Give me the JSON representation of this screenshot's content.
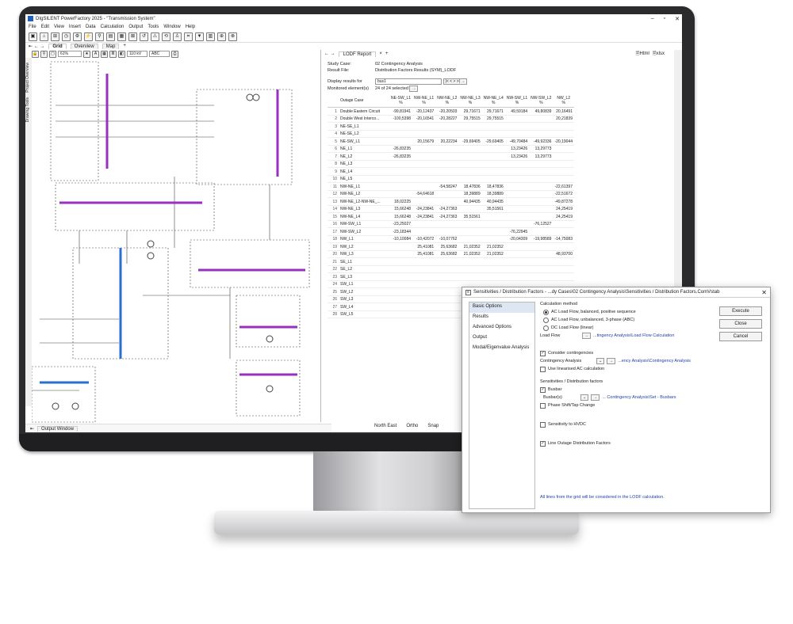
{
  "window": {
    "title": "DIgSILENT PowerFactory 2025 - \"Transmission System\""
  },
  "menu": [
    "File",
    "Edit",
    "View",
    "Insert",
    "Data",
    "Calculation",
    "Output",
    "Tools",
    "Window",
    "Help"
  ],
  "left_tabs": [
    "Grid",
    "Overview",
    "Map"
  ],
  "left_side_tabs": [
    "Project Overview",
    "Drawing Tools"
  ],
  "zoom": "61%",
  "voltage_filter": "110 kV",
  "phase_filter": "ABC",
  "report": {
    "tab": "LODF Report",
    "study_case_label": "Study Case:",
    "study_case": "02 Contingency Analysis",
    "result_file_label": "Result File:",
    "result_file": "Distribution Factors Results (SYM)_LODF",
    "display_for_label": "Display results for",
    "display_for": "bus1",
    "monitored_label": "Monitored element(s)",
    "monitored": "24 of 24 selected",
    "export_html": "Html",
    "export_xlsx": "xlsx",
    "columns": [
      "Outage Case",
      "NE-SW_L1",
      "NW-NE_L1",
      "NW-NE_L2",
      "NW-NE_L3",
      "NW-NE_L4",
      "NW-SW_L1",
      "NW-SW_L2",
      "NW_L2"
    ],
    "unit": "%",
    "rows": [
      [
        "Double Eastern Circuit",
        "-99,81941",
        "-20,12437",
        "-20,20503",
        "29,71671",
        "29,71671",
        "49,59184",
        "49,80839",
        "20,16491"
      ],
      [
        "Double West Interco...",
        "-100,5398",
        "-20,16541",
        "-20,28227",
        "29,75515",
        "29,75515",
        "",
        "",
        "20,21839"
      ],
      [
        "NE-SE_L1",
        "",
        "",
        "",
        "",
        "",
        "",
        "",
        ""
      ],
      [
        "NE-SE_L2",
        "",
        "",
        "",
        "",
        "",
        "",
        "",
        ""
      ],
      [
        "NE-SW_L1",
        "",
        "20,15679",
        "20,22234",
        "-29,69405",
        "-29,69405",
        "-49,70484",
        "-49,92336",
        "-20,19044"
      ],
      [
        "NE_L1",
        "-26,83235",
        "",
        "",
        "",
        "",
        "13,23426",
        "13,29773",
        ""
      ],
      [
        "NE_L2",
        "-26,83235",
        "",
        "",
        "",
        "",
        "13,23426",
        "13,29773",
        ""
      ],
      [
        "NE_L3",
        "",
        "",
        "",
        "",
        "",
        "",
        "",
        ""
      ],
      [
        "NE_L4",
        "",
        "",
        "",
        "",
        "",
        "",
        "",
        ""
      ],
      [
        "NE_L5",
        "",
        "",
        "",
        "",
        "",
        "",
        "",
        ""
      ],
      [
        "NW-NE_L1",
        "",
        "",
        "-54,58247",
        "18,47836",
        "18,47836",
        "",
        "",
        "-22,61397"
      ],
      [
        "NW-NE_L2",
        "",
        "-54,64618",
        "",
        "18,39889",
        "18,39889",
        "",
        "",
        "-22,51672"
      ],
      [
        "NW-NE_L2-NW-NE_...",
        "18,02225",
        "",
        "",
        "40,94435",
        "40,94435",
        "",
        "",
        "-49,87278"
      ],
      [
        "NW-NE_L3",
        "15,66248",
        "-24,23841",
        "-24,27363",
        "",
        "35,51561",
        "",
        "",
        "24,25419"
      ],
      [
        "NW-NE_L4",
        "15,66248",
        "-24,23841",
        "-24,27363",
        "35,51561",
        "",
        "",
        "",
        "24,25419"
      ],
      [
        "NW-SW_L1",
        "-23,25027",
        "",
        "",
        "",
        "",
        "",
        "-76,12527",
        ""
      ],
      [
        "NW-SW_L2",
        "-23,18344",
        "",
        "",
        "",
        "",
        "-76,22945",
        "",
        ""
      ],
      [
        "NW_L1",
        "-10,10084",
        "-10,42072",
        "-10,07762",
        "",
        "",
        "-20,04309",
        "-19,98589",
        "-14,75083"
      ],
      [
        "NW_L2",
        "",
        "25,41081",
        "25,63682",
        "21,02352",
        "21,02352",
        "",
        "",
        ""
      ],
      [
        "NW_L3",
        "",
        "25,41081",
        "25,63682",
        "21,02352",
        "21,02352",
        "",
        "",
        "48,93700"
      ],
      [
        "SE_L1",
        "",
        "",
        "",
        "",
        "",
        "",
        "",
        ""
      ],
      [
        "SE_L2",
        "",
        "",
        "",
        "",
        "",
        "",
        "",
        ""
      ],
      [
        "SE_L3",
        "",
        "",
        "",
        "",
        "",
        "",
        "",
        ""
      ],
      [
        "SW_L1",
        "",
        "",
        "",
        "",
        "",
        "",
        "",
        ""
      ],
      [
        "SW_L2",
        "",
        "",
        "",
        "",
        "",
        "",
        "",
        ""
      ],
      [
        "SW_L3",
        "",
        "",
        "",
        "",
        "",
        "",
        "",
        ""
      ],
      [
        "SW_L4",
        "",
        "",
        "",
        "",
        "",
        "",
        "",
        ""
      ],
      [
        "SW_L5",
        "",
        "",
        "",
        "",
        "",
        "",
        "",
        ""
      ]
    ]
  },
  "output_window": "Output Window",
  "statusbar": {
    "location": "North East",
    "ortho": "Ortho",
    "snap": "Snap"
  },
  "dialog": {
    "title": "Sensitivities / Distribution Factors - ...dy Cases\\02 Contingency Analysis\\Sensitivities / Distribution Factors.ComVstab",
    "nav": [
      "Basic Options",
      "Results",
      "Advanced Options",
      "Output",
      "Modal/Eigenvalue Analysis"
    ],
    "calc_method_label": "Calculation method",
    "methods": [
      "AC Load Flow, balanced, positive sequence",
      "AC Load Flow, unbalanced, 3-phase (ABC)",
      "DC Load Flow (linear)"
    ],
    "load_flow_label": "Load Flow",
    "load_flow_link": "...tingency Analysis\\Load Flow Calculation",
    "consider_contingencies": "Consider contingencies",
    "contingency_label": "Contingency Analysis",
    "contingency_link": "...ency Analysis\\Contingency Analysis",
    "linearised": "Use linearised AC calculation",
    "sens_label": "Sensitivities / Distribution factors",
    "busbar": "Busbar",
    "busbars_label": "Busbar(s)",
    "busbars_link": "... Contingency Analysis\\Set - Busbars",
    "phase_shift": "Phase Shift/Tap Change",
    "hvdc": "Sensitivity to HVDC",
    "lodf": "Line Outage Distribution Factors",
    "note": "All lines from the grid will be considered in the LODF calculation.",
    "buttons": [
      "Execute",
      "Close",
      "Cancel"
    ]
  }
}
